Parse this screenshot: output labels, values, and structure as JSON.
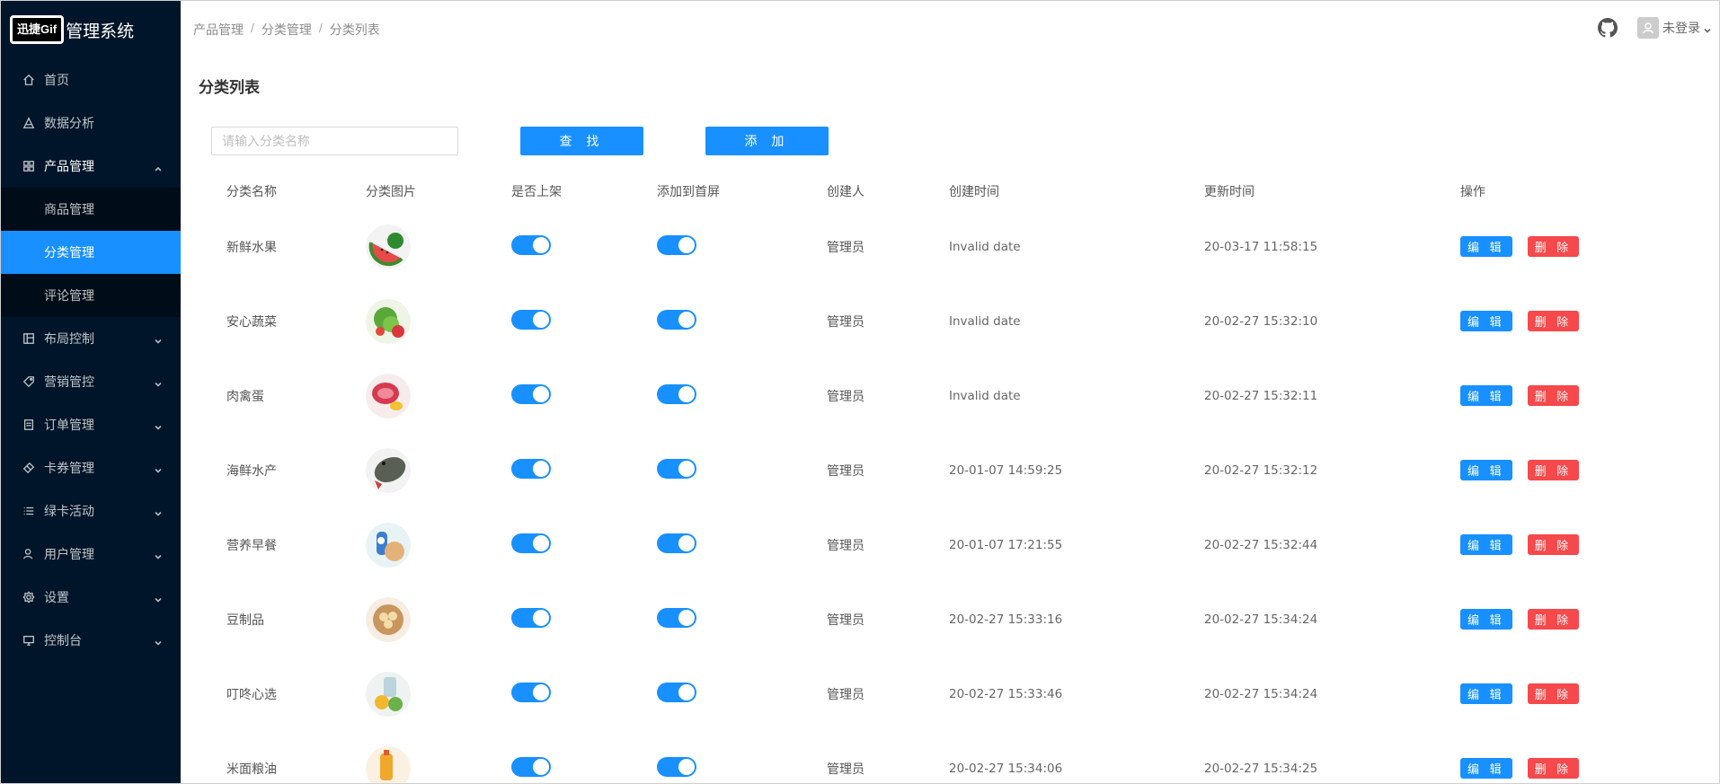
{
  "brand": {
    "logo_text": "迅捷Gif",
    "title": "管理系统"
  },
  "sidebar": {
    "items": [
      {
        "label": "首页",
        "icon": "home-icon"
      },
      {
        "label": "数据分析",
        "icon": "chart-icon"
      },
      {
        "label": "产品管理",
        "icon": "appstore-icon",
        "open": true,
        "children": [
          {
            "label": "商品管理"
          },
          {
            "label": "分类管理",
            "active": true
          },
          {
            "label": "评论管理"
          }
        ]
      },
      {
        "label": "布局控制",
        "icon": "layout-icon"
      },
      {
        "label": "营销管控",
        "icon": "tag-icon"
      },
      {
        "label": "订单管理",
        "icon": "order-icon"
      },
      {
        "label": "卡券管理",
        "icon": "ticket-icon"
      },
      {
        "label": "绿卡活动",
        "icon": "list-icon"
      },
      {
        "label": "用户管理",
        "icon": "user-icon"
      },
      {
        "label": "设置",
        "icon": "gear-icon"
      },
      {
        "label": "控制台",
        "icon": "desktop-icon"
      }
    ]
  },
  "header": {
    "breadcrumb": [
      "产品管理",
      "分类管理",
      "分类列表"
    ],
    "user_label": "未登录"
  },
  "page": {
    "title": "分类列表"
  },
  "search": {
    "placeholder": "请输入分类名称",
    "value": ""
  },
  "toolbar": {
    "search_label": "查 找",
    "add_label": "添 加"
  },
  "table": {
    "columns": [
      "分类名称",
      "分类图片",
      "是否上架",
      "添加到首屏",
      "创建人",
      "创建时间",
      "更新时间",
      "操作"
    ],
    "edit_label": "编 辑",
    "delete_label": "删 除",
    "rows": [
      {
        "name": "新鲜水果",
        "creator": "管理员",
        "created": "Invalid date",
        "updated": "20-03-17 11:58:15",
        "on_shelf": true,
        "home": true,
        "image": "watermelon"
      },
      {
        "name": "安心蔬菜",
        "creator": "管理员",
        "created": "Invalid date",
        "updated": "20-02-27 15:32:10",
        "on_shelf": true,
        "home": true,
        "image": "vegetables"
      },
      {
        "name": "肉禽蛋",
        "creator": "管理员",
        "created": "Invalid date",
        "updated": "20-02-27 15:32:11",
        "on_shelf": true,
        "home": true,
        "image": "meat"
      },
      {
        "name": "海鲜水产",
        "creator": "管理员",
        "created": "20-01-07 14:59:25",
        "updated": "20-02-27 15:32:12",
        "on_shelf": true,
        "home": true,
        "image": "fish"
      },
      {
        "name": "营养早餐",
        "creator": "管理员",
        "created": "20-01-07 17:21:55",
        "updated": "20-02-27 15:32:44",
        "on_shelf": true,
        "home": true,
        "image": "breakfast"
      },
      {
        "name": "豆制品",
        "creator": "管理员",
        "created": "20-02-27 15:33:16",
        "updated": "20-02-27 15:34:24",
        "on_shelf": true,
        "home": true,
        "image": "tofu"
      },
      {
        "name": "叮咚心选",
        "creator": "管理员",
        "created": "20-02-27 15:33:46",
        "updated": "20-02-27 15:34:24",
        "on_shelf": true,
        "home": true,
        "image": "selection"
      },
      {
        "name": "米面粮油",
        "creator": "管理员",
        "created": "20-02-27 15:34:06",
        "updated": "20-02-27 15:34:25",
        "on_shelf": true,
        "home": true,
        "image": "oil"
      }
    ]
  }
}
